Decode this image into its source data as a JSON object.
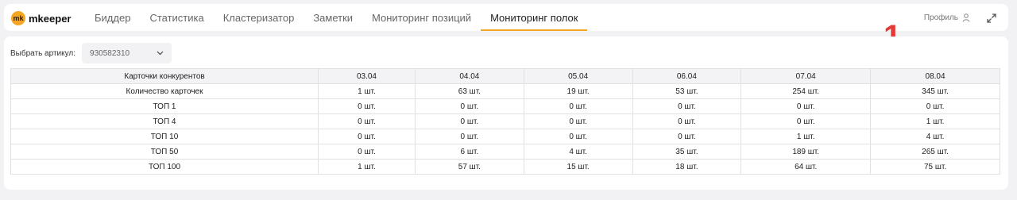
{
  "app": {
    "logo_badge": "mk",
    "logo_text": "mkeeper"
  },
  "nav": {
    "items": [
      "Биддер",
      "Статистика",
      "Кластеризатор",
      "Заметки",
      "Мониторинг позиций",
      "Мониторинг полок"
    ],
    "active_index": 5
  },
  "header": {
    "profile_label": "Профиль"
  },
  "annotation": "1",
  "selector": {
    "label": "Выбрать артикул:",
    "value": "930582310"
  },
  "table": {
    "columns": [
      "Карточки конкурентов",
      "03.04",
      "04.04",
      "05.04",
      "06.04",
      "07.04",
      "08.04"
    ],
    "rows": [
      [
        "Количество карточек",
        "1 шт.",
        "63 шт.",
        "19 шт.",
        "53 шт.",
        "254 шт.",
        "345 шт."
      ],
      [
        "ТОП 1",
        "0 шт.",
        "0 шт.",
        "0 шт.",
        "0 шт.",
        "0 шт.",
        "0 шт."
      ],
      [
        "ТОП 4",
        "0 шт.",
        "0 шт.",
        "0 шт.",
        "0 шт.",
        "0 шт.",
        "1 шт."
      ],
      [
        "ТОП 10",
        "0 шт.",
        "0 шт.",
        "0 шт.",
        "0 шт.",
        "1 шт.",
        "4 шт."
      ],
      [
        "ТОП 50",
        "0 шт.",
        "6 шт.",
        "4 шт.",
        "35 шт.",
        "189 шт.",
        "265 шт."
      ],
      [
        "ТОП 100",
        "1 шт.",
        "57 шт.",
        "15 шт.",
        "18 шт.",
        "64 шт.",
        "75 шт."
      ]
    ]
  },
  "colors": {
    "accent": "#f5a623",
    "annotation": "#e53935",
    "background": "#f2f2f4"
  },
  "icons": {
    "profile": "user-icon",
    "expand": "expand-icon",
    "dropdown": "chevron-down-icon"
  }
}
